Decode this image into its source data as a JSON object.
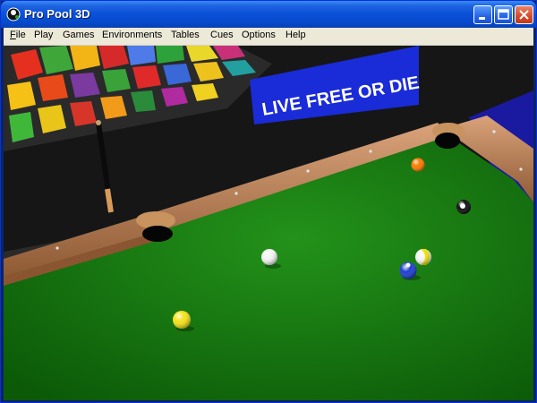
{
  "window": {
    "title": "Pro Pool 3D",
    "app_icon": "pool-ball-icon",
    "controls": [
      "minimize-icon",
      "maximize-icon",
      "close-icon"
    ]
  },
  "menu": {
    "items": [
      {
        "label": "File",
        "mnemonic": "F"
      },
      {
        "label": "Play"
      },
      {
        "label": "Games"
      },
      {
        "label": "Environments"
      },
      {
        "label": "Tables"
      },
      {
        "label": "Cues"
      },
      {
        "label": "Options"
      },
      {
        "label": "Help"
      }
    ]
  },
  "scene": {
    "banner_text": "LIVE FREE OR DIE",
    "felt_color": "#1f8a14",
    "rail_color": "#b87a4a",
    "balls": [
      {
        "name": "cue-ball",
        "color": "#f4f4f4"
      },
      {
        "name": "orange-solid-ball",
        "color": "#ff7a00"
      },
      {
        "name": "eight-ball",
        "color": "#111111"
      },
      {
        "name": "yellow-stripe-ball",
        "color": "#f0e000"
      },
      {
        "name": "blue-solid-ball",
        "color": "#1f3fd0"
      },
      {
        "name": "yellow-solid-ball",
        "color": "#f5e21a"
      }
    ]
  }
}
